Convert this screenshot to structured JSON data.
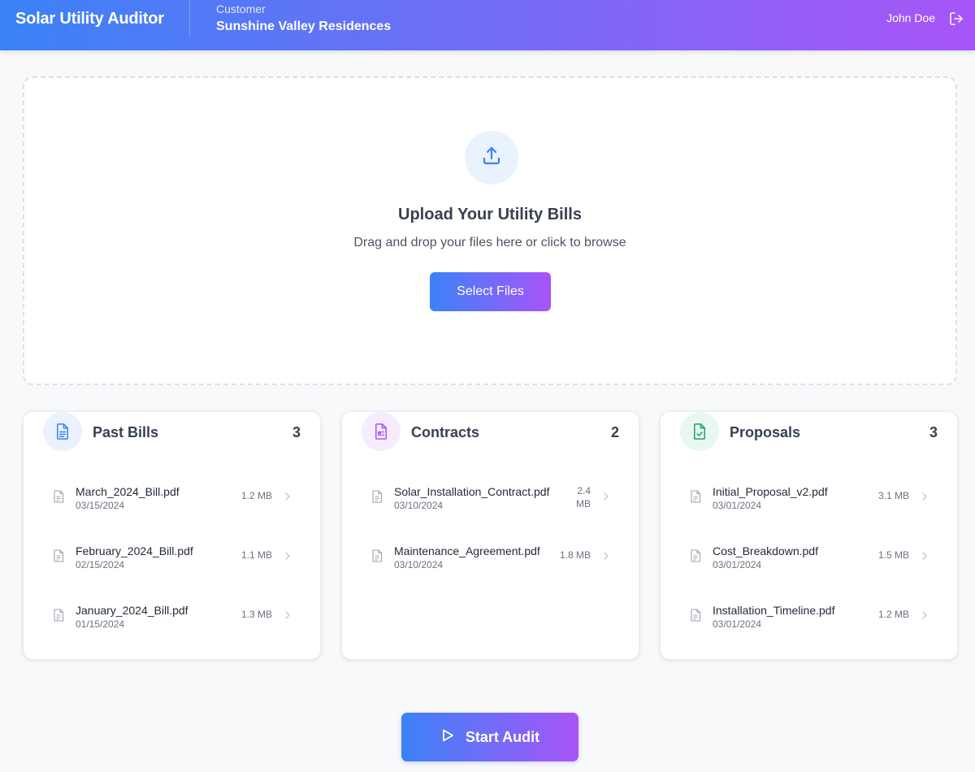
{
  "header": {
    "app_title": "Solar Utility Auditor",
    "customer_label": "Customer",
    "customer_name": "Sunshine Valley Residences",
    "user_name": "John Doe",
    "logout_icon": "logout-icon"
  },
  "upload": {
    "icon": "upload-icon",
    "title": "Upload Your Utility Bills",
    "subtitle": "Drag and drop your files here or click to browse",
    "button_label": "Select Files"
  },
  "cards": [
    {
      "title": "Past Bills",
      "count": "3",
      "icon": "document-icon",
      "icon_color": "#3b82f6",
      "icon_bg": "#eaf2fe",
      "files": [
        {
          "name": "March_2024_Bill.pdf",
          "date": "03/15/2024",
          "size": "1.2 MB"
        },
        {
          "name": "February_2024_Bill.pdf",
          "date": "02/15/2024",
          "size": "1.1 MB"
        },
        {
          "name": "January_2024_Bill.pdf",
          "date": "01/15/2024",
          "size": "1.3 MB"
        }
      ]
    },
    {
      "title": "Contracts",
      "count": "2",
      "icon": "contract-icon",
      "icon_color": "#a855f7",
      "icon_bg": "#f5ecfe",
      "files": [
        {
          "name": "Solar_Installation_Contract.pdf",
          "date": "03/10/2024",
          "size": "2.4 MB"
        },
        {
          "name": "Maintenance_Agreement.pdf",
          "date": "03/10/2024",
          "size": "1.8 MB"
        }
      ]
    },
    {
      "title": "Proposals",
      "count": "3",
      "icon": "document-check-icon",
      "icon_color": "#22a06b",
      "icon_bg": "#e8f8f0",
      "files": [
        {
          "name": "Initial_Proposal_v2.pdf",
          "date": "03/01/2024",
          "size": "3.1 MB"
        },
        {
          "name": "Cost_Breakdown.pdf",
          "date": "03/01/2024",
          "size": "1.5 MB"
        },
        {
          "name": "Installation_Timeline.pdf",
          "date": "03/01/2024",
          "size": "1.2 MB"
        }
      ]
    }
  ],
  "start_audit": {
    "label": "Start Audit",
    "icon": "play-icon"
  }
}
